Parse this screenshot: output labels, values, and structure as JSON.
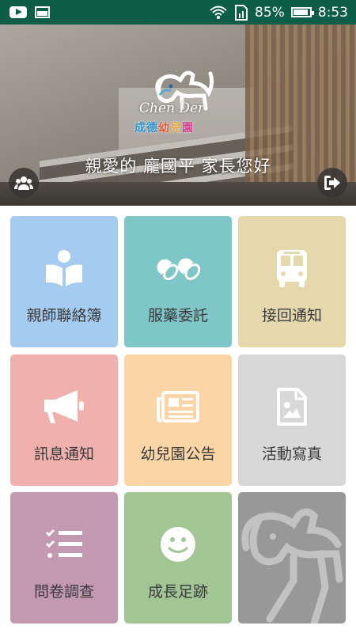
{
  "status_bar": {
    "battery": "85%",
    "time": "8:53",
    "icons": [
      "youtube-icon",
      "gallery-icon",
      "wifi-icon",
      "sim-icon",
      "battery-icon"
    ]
  },
  "hero": {
    "logo_text": "Chen Der",
    "logo_chinese": [
      "成",
      "德",
      "幼",
      "兒",
      "園"
    ],
    "greeting": "親愛的 龐國平 家長您好",
    "left_button_icon": "group-icon",
    "right_button_icon": "logout-icon"
  },
  "tiles": [
    {
      "label": "親師聯絡簿",
      "icon": "book-reader-icon",
      "color": "#a6cbf0"
    },
    {
      "label": "服藥委託",
      "icon": "pills-icon",
      "color": "#7fc6c8"
    },
    {
      "label": "接回通知",
      "icon": "bus-icon",
      "color": "#e6d8ad"
    },
    {
      "label": "訊息通知",
      "icon": "megaphone-icon",
      "color": "#f0b1ae"
    },
    {
      "label": "幼兒園公告",
      "icon": "newspaper-icon",
      "color": "#fbd5a5"
    },
    {
      "label": "活動寫真",
      "icon": "image-file-icon",
      "color": "#d9d8d9"
    },
    {
      "label": "問卷調查",
      "icon": "checklist-icon",
      "color": "#c398b1"
    },
    {
      "label": "成長足跡",
      "icon": "smile-icon",
      "color": "#a2c594"
    },
    {
      "label": "",
      "icon": "dog-logo-icon",
      "color": "#999899"
    }
  ]
}
